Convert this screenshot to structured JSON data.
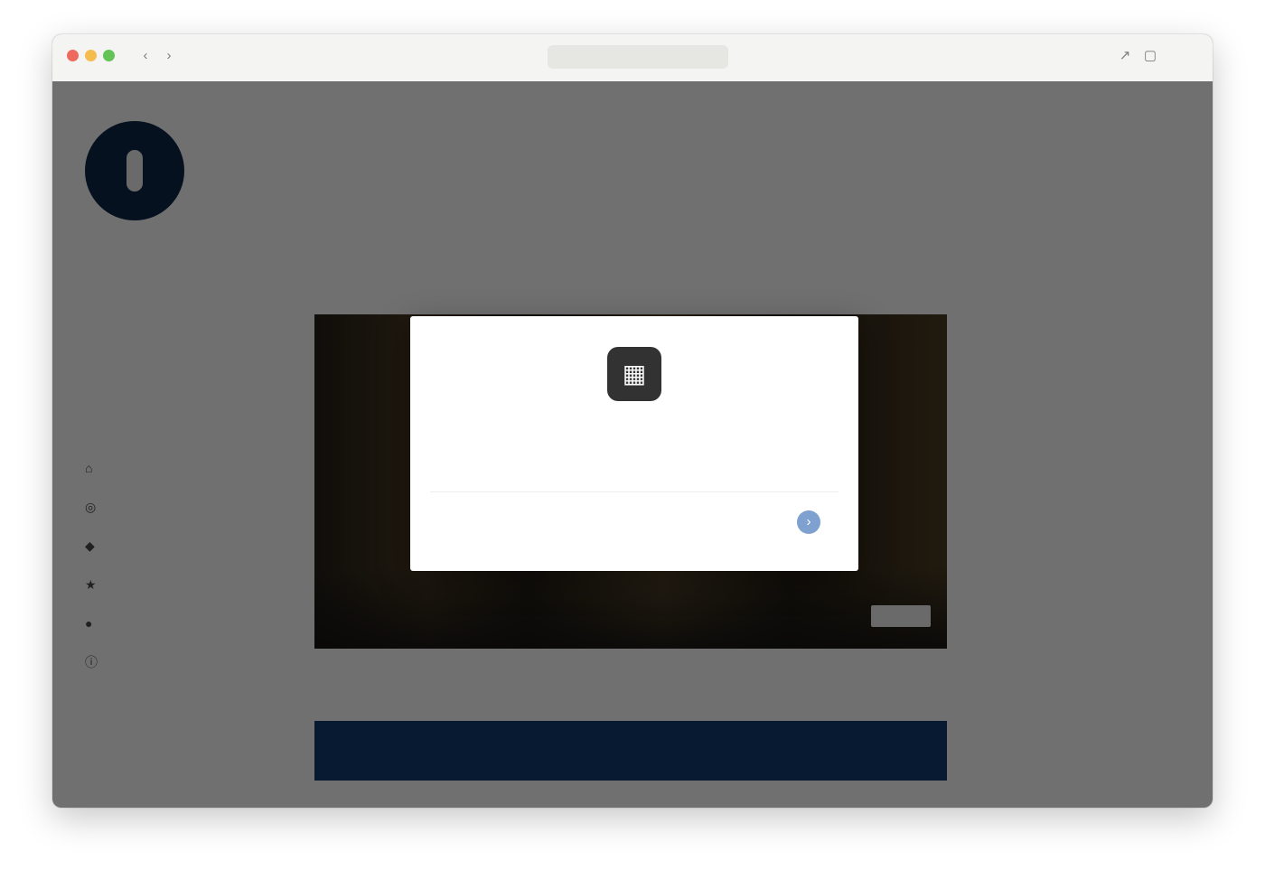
{
  "window": {
    "toolbar": {
      "back_icon": "chevron-left-icon",
      "forward_icon": "chevron-right-icon",
      "share_icon": "share-icon",
      "url_text": "",
      "tabs_icon": "tabs-icon"
    }
  },
  "top_nav": {
    "items": [
      "",
      "",
      "",
      "",
      ""
    ]
  },
  "sidebar": {
    "site_name": "",
    "description": "",
    "items": [
      {
        "icon": "home-icon",
        "label": ""
      },
      {
        "icon": "globe-icon",
        "label": ""
      },
      {
        "icon": "tag-icon",
        "label": ""
      },
      {
        "icon": "star-icon",
        "label": ""
      },
      {
        "icon": "user-icon",
        "label": ""
      },
      {
        "icon": "info-icon",
        "label": ""
      }
    ],
    "footer_note": ""
  },
  "article": {
    "title": "",
    "meta": "",
    "hero_image": "dark-warm-photo",
    "share_bar": {
      "items": [
        "",
        "",
        "",
        "",
        "",
        ""
      ]
    }
  },
  "right_column": {
    "heading": "",
    "lines": [
      "",
      "",
      "",
      ""
    ]
  },
  "dialog": {
    "app_icon": "app-logo-icon",
    "title": "",
    "subtitle": "",
    "account_name": "",
    "account_email": "",
    "continue_icon": "arrow-icon"
  },
  "colors": {
    "brand_dark": "#0f2748",
    "share_bar_blue": "#113c72",
    "overlay": "#000000",
    "dialog_background": "#ffffff",
    "accent_blue": "#7ea1d0"
  }
}
